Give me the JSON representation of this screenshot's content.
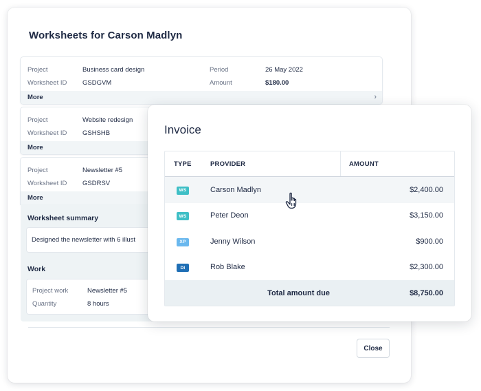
{
  "worksheets_panel": {
    "title": "Worksheets for Carson Madlyn",
    "cards": [
      {
        "project_label": "Project",
        "project_value": "Business card design",
        "id_label": "Worksheet ID",
        "id_value": "GSDGVM",
        "period_label": "Period",
        "period_value": "26 May 2022",
        "amount_label": "Amount",
        "amount_value": "$180.00",
        "more_label": "More"
      },
      {
        "project_label": "Project",
        "project_value": "Website redesign",
        "id_label": "Worksheet ID",
        "id_value": "GSHSHB",
        "more_label": "More"
      },
      {
        "project_label": "Project",
        "project_value": "Newsletter #5",
        "id_label": "Worksheet ID",
        "id_value": "GSDRSV",
        "more_label": "More"
      }
    ],
    "summary": {
      "title": "Worksheet summary",
      "text": "Designed the newsletter with 6 illust"
    },
    "work": {
      "title": "Work",
      "project_work_label": "Project work",
      "project_work_value": "Newsletter #5",
      "quantity_label": "Quantity",
      "quantity_value": "8 hours"
    },
    "close_label": "Close"
  },
  "invoice": {
    "title": "Invoice",
    "headers": {
      "type": "TYPE",
      "provider": "PROVIDER",
      "amount": "AMOUNT"
    },
    "rows": [
      {
        "type": "WS",
        "type_color": "#3fbfc6",
        "provider": "Carson Madlyn",
        "amount": "$2,400.00"
      },
      {
        "type": "WS",
        "type_color": "#3fbfc6",
        "provider": "Peter Deon",
        "amount": "$3,150.00"
      },
      {
        "type": "XP",
        "type_color": "#6ab8ee",
        "provider": "Jenny Wilson",
        "amount": "$900.00"
      },
      {
        "type": "DI",
        "type_color": "#1f6fb5",
        "provider": "Rob Blake",
        "amount": "$2,300.00"
      }
    ],
    "total_label": "Total amount due",
    "total_value": "$8,750.00"
  },
  "icons": {
    "chevron": "chevron-right-icon",
    "cursor": "hand-pointer-icon"
  }
}
